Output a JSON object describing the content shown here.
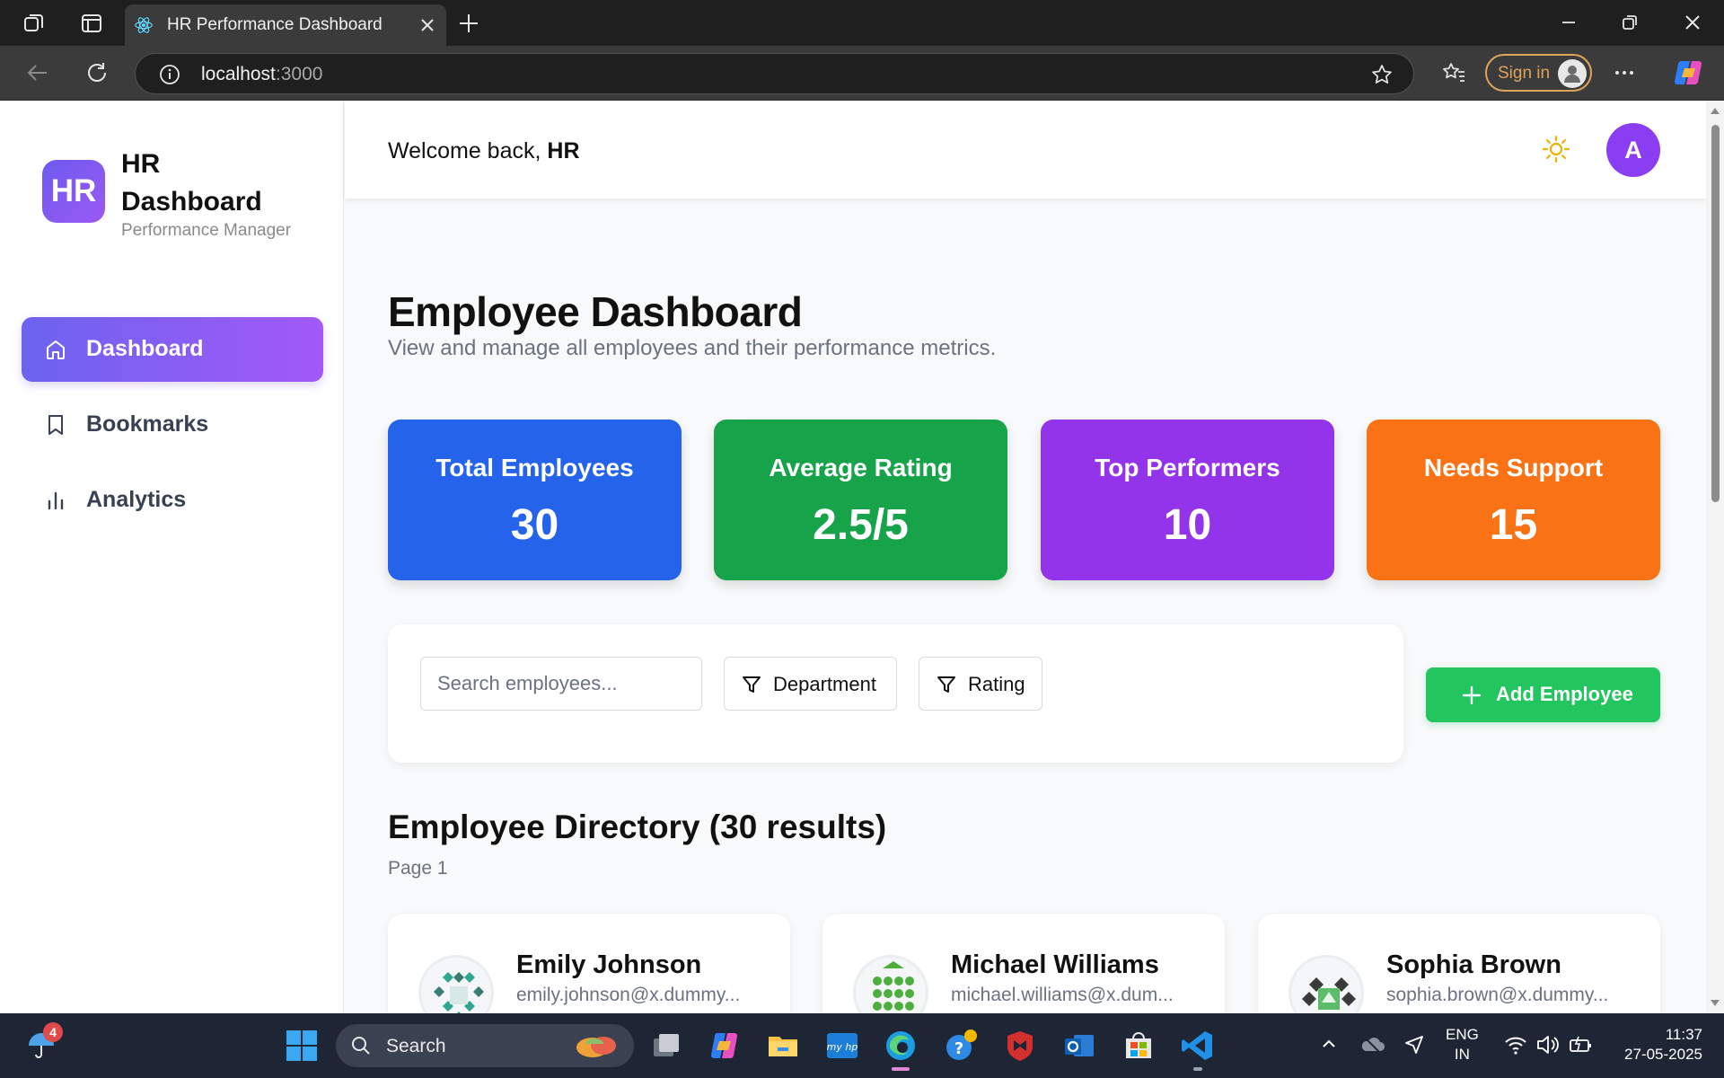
{
  "browser": {
    "tab_title": "HR Performance Dashboard",
    "url_host": "localhost",
    "url_port": ":3000",
    "signin_label": "Sign in"
  },
  "sidebar": {
    "logo_initials": "HR",
    "title": "HR Dashboard",
    "subtitle": "Performance Manager",
    "items": [
      {
        "label": "Dashboard",
        "icon": "home-icon",
        "active": true
      },
      {
        "label": "Bookmarks",
        "icon": "bookmark-icon",
        "active": false
      },
      {
        "label": "Analytics",
        "icon": "bar-chart-icon",
        "active": false
      }
    ]
  },
  "header": {
    "welcome_prefix": "Welcome back, ",
    "user_name": "HR",
    "avatar_initial": "A",
    "theme_icon": "sun-icon"
  },
  "page": {
    "title": "Employee Dashboard",
    "subtitle": "View and manage all employees and their performance metrics."
  },
  "stats": [
    {
      "label": "Total Employees",
      "value": "30",
      "color": "#2563eb"
    },
    {
      "label": "Average Rating",
      "value": "2.5/5",
      "color": "#16a34a"
    },
    {
      "label": "Top Performers",
      "value": "10",
      "color": "#9333ea"
    },
    {
      "label": "Needs Support",
      "value": "15",
      "color": "#f97316"
    }
  ],
  "filters": {
    "search_placeholder": "Search employees...",
    "department_label": "Department",
    "rating_label": "Rating",
    "add_label": "Add Employee"
  },
  "directory": {
    "title": "Employee Directory (30 results)",
    "page_label": "Page 1",
    "employees": [
      {
        "name": "Emily Johnson",
        "email": "emily.johnson@x.dummy...",
        "avatar_color": "#2fa58f"
      },
      {
        "name": "Michael Williams",
        "email": "michael.williams@x.dum...",
        "avatar_color": "#4cae3c"
      },
      {
        "name": "Sophia Brown",
        "email": "sophia.brown@x.dummy...",
        "avatar_color": "#3a3a3a"
      }
    ]
  },
  "taskbar": {
    "notification_count": "4",
    "search_label": "Search",
    "lang_primary": "ENG",
    "lang_secondary": "IN",
    "time": "11:37",
    "date": "27-05-2025"
  }
}
